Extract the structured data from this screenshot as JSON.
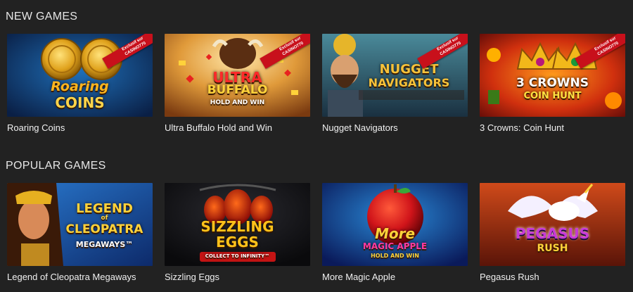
{
  "sections": [
    {
      "title": "NEW GAMES",
      "games": [
        {
          "name": "Roaring Coins",
          "art": [
            "Roaring",
            "COINS"
          ],
          "ribbon": [
            "Exclusif sur",
            "CASINO770"
          ]
        },
        {
          "name": "Ultra Buffalo Hold and Win",
          "art": [
            "ULTRA",
            "BUFFALO",
            "HOLD AND WIN"
          ],
          "ribbon": [
            "Exclusif sur",
            "CASINO770"
          ]
        },
        {
          "name": "Nugget Navigators",
          "art": [
            "NUGGET",
            "NAVIGATORS"
          ],
          "ribbon": [
            "Exclusif sur",
            "CASINO770"
          ]
        },
        {
          "name": "3 Crowns: Coin Hunt",
          "art": [
            "3 CROWNS",
            "COIN HUNT"
          ],
          "ribbon": [
            "Exclusif sur",
            "CASINO770"
          ]
        }
      ]
    },
    {
      "title": "POPULAR GAMES",
      "games": [
        {
          "name": "Legend of Cleopatra Megaways",
          "art": [
            "LEGEND",
            "of",
            "CLEOPATRA",
            "MEGAWAYS™"
          ]
        },
        {
          "name": "Sizzling Eggs",
          "art": [
            "SIZZLING",
            "EGGS",
            "COLLECT TO INFINITY™"
          ]
        },
        {
          "name": "More Magic Apple",
          "art": [
            "More",
            "MAGIC APPLE",
            "HOLD AND WIN"
          ]
        },
        {
          "name": "Pegasus Rush",
          "art": [
            "PEGASUS",
            "RUSH"
          ]
        }
      ]
    }
  ]
}
